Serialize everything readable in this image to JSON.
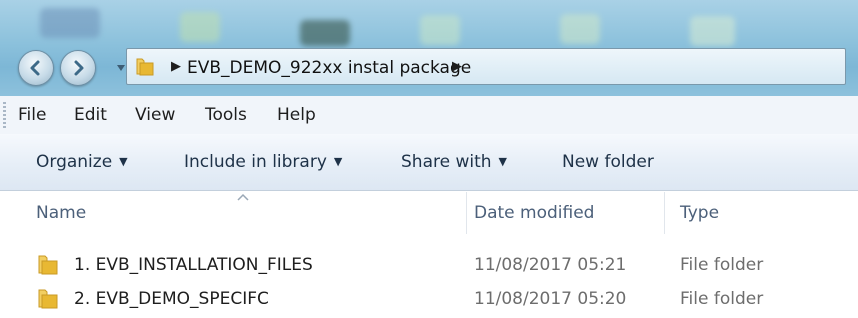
{
  "window": {
    "address_path": "EVB_DEMO_922xx instal package",
    "nav_icons": [
      "back-arrow-icon",
      "forward-arrow-icon",
      "history-dropdown-icon"
    ]
  },
  "menu_bar": {
    "items": [
      "File",
      "Edit",
      "View",
      "Tools",
      "Help"
    ]
  },
  "command_bar": {
    "organize": "Organize",
    "include_in_library": "Include in library",
    "share_with": "Share with",
    "new_folder": "New folder"
  },
  "columns": {
    "name": "Name",
    "date_modified": "Date modified",
    "type": "Type"
  },
  "files": [
    {
      "name": "1. EVB_INSTALLATION_FILES",
      "date_modified": "11/08/2017 05:21",
      "type": "File folder"
    },
    {
      "name": "2. EVB_DEMO_SPECIFC",
      "date_modified": "11/08/2017 05:20",
      "type": "File folder"
    }
  ],
  "colors": {
    "folder_yellow": "#e8b833",
    "title_band": "#8fc3dd"
  }
}
